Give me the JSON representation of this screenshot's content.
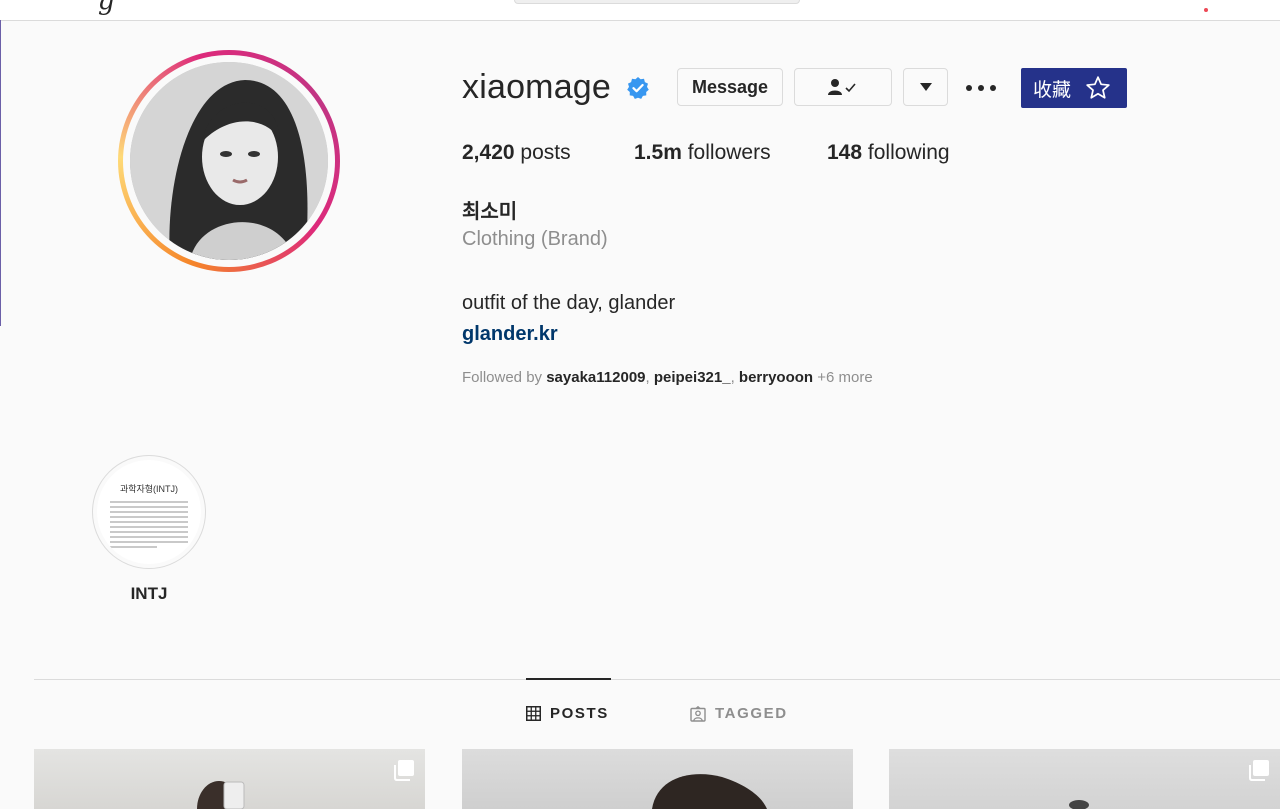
{
  "profile": {
    "username": "xiaomage",
    "full_name": "최소미",
    "category": "Clothing (Brand)",
    "bio": "outfit of the day, glander",
    "link": "glander.kr"
  },
  "buttons": {
    "message": "Message",
    "collect": "收藏"
  },
  "stats": {
    "posts_count": "2,420",
    "posts_label": "posts",
    "followers_count": "1.5m",
    "followers_label": "followers",
    "following_count": "148",
    "following_label": "following"
  },
  "followed_by": {
    "prefix": "Followed by",
    "accounts": [
      "sayaka112009",
      "peipei321_",
      "berryooon"
    ],
    "more": "+6 more"
  },
  "highlights": [
    {
      "cover_title": "과학자형(INTJ)",
      "label": "INTJ"
    }
  ],
  "tabs": [
    {
      "label": "POSTS",
      "icon": "grid-icon",
      "active": true
    },
    {
      "label": "TAGGED",
      "icon": "tag-person-icon",
      "active": false
    }
  ],
  "colors": {
    "verified_blue": "#3897f0",
    "link_blue": "#00376b",
    "collect_bg": "#25328a"
  }
}
